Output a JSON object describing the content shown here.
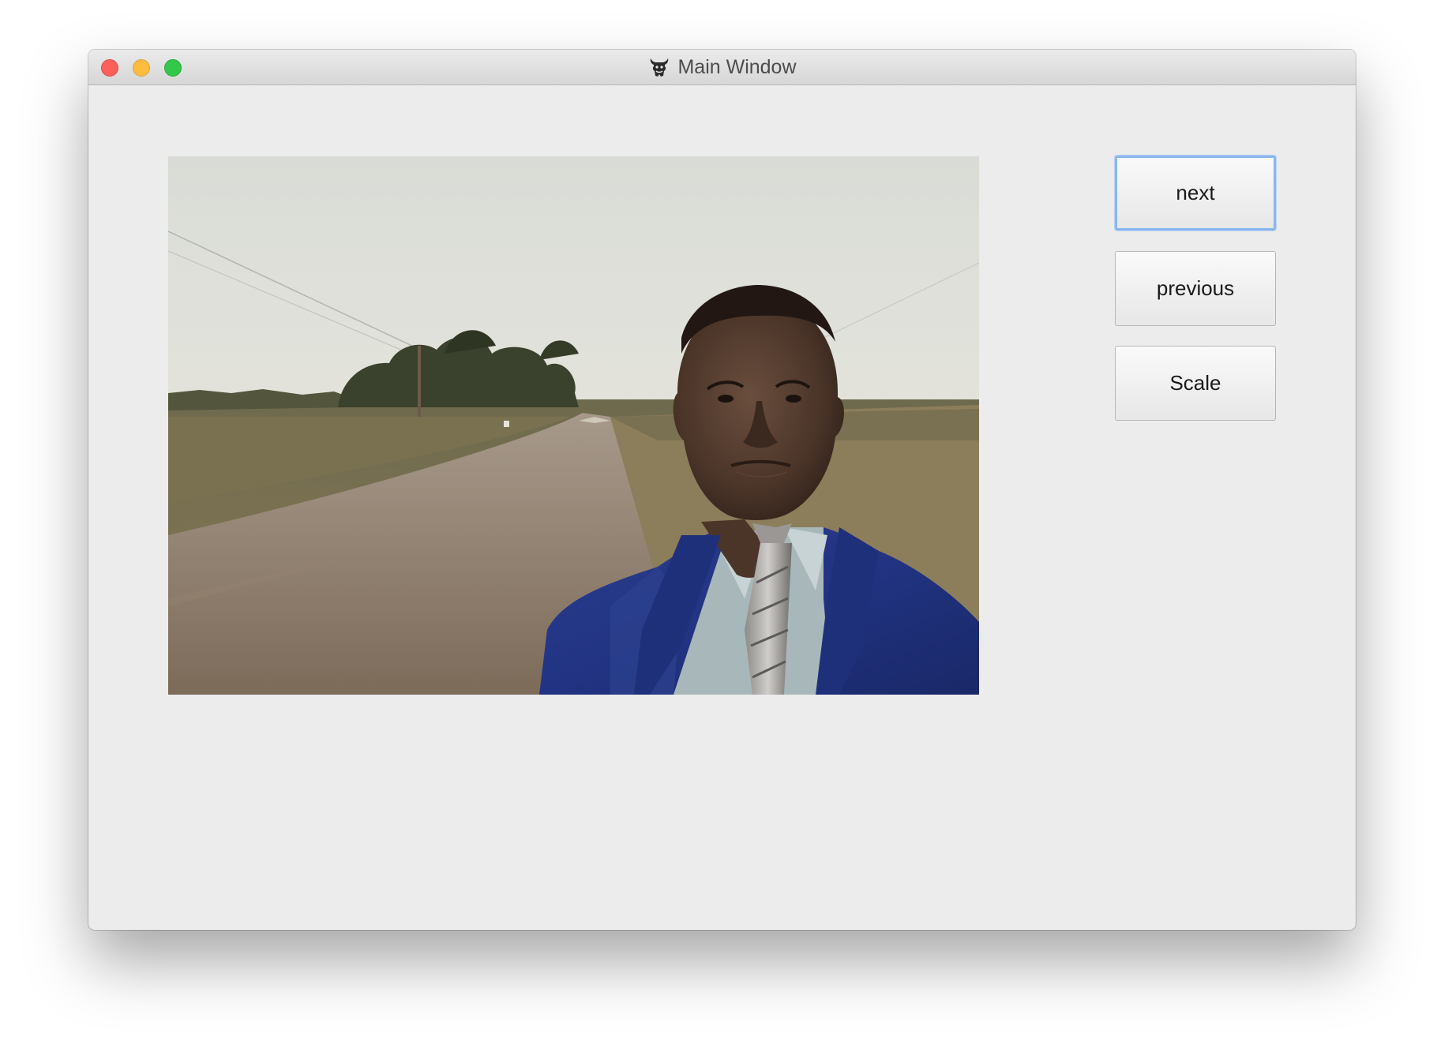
{
  "window": {
    "title": "Main Window",
    "title_icon": "gnu-app-icon"
  },
  "image_viewer": {
    "content": "portrait-photo"
  },
  "buttons": {
    "next": "next",
    "previous": "previous",
    "scale": "Scale"
  },
  "colors": {
    "close": "#fc605b",
    "minimize": "#fdbc40",
    "maximize": "#34c84a",
    "focus_ring": "#8ab6ef",
    "window_bg": "#ececec"
  }
}
